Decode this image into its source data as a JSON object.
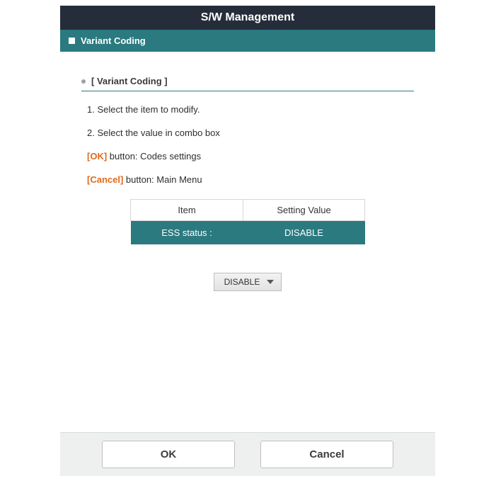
{
  "header": {
    "title": "S/W Management",
    "subheader": "Variant Coding"
  },
  "section": {
    "title": "[ Variant Coding ]"
  },
  "instructions": {
    "line1": "1. Select the item to modify.",
    "line2": "2. Select the value in combo box",
    "ok_label": "[OK]",
    "ok_text": " button: Codes settings",
    "cancel_label": "[Cancel]",
    "cancel_text": " button: Main Menu"
  },
  "table": {
    "headers": {
      "item": "Item",
      "value": "Setting Value"
    },
    "row": {
      "item": "ESS status :",
      "value": "DISABLE"
    }
  },
  "combo": {
    "selected": "DISABLE"
  },
  "buttons": {
    "ok": "OK",
    "cancel": "Cancel"
  }
}
